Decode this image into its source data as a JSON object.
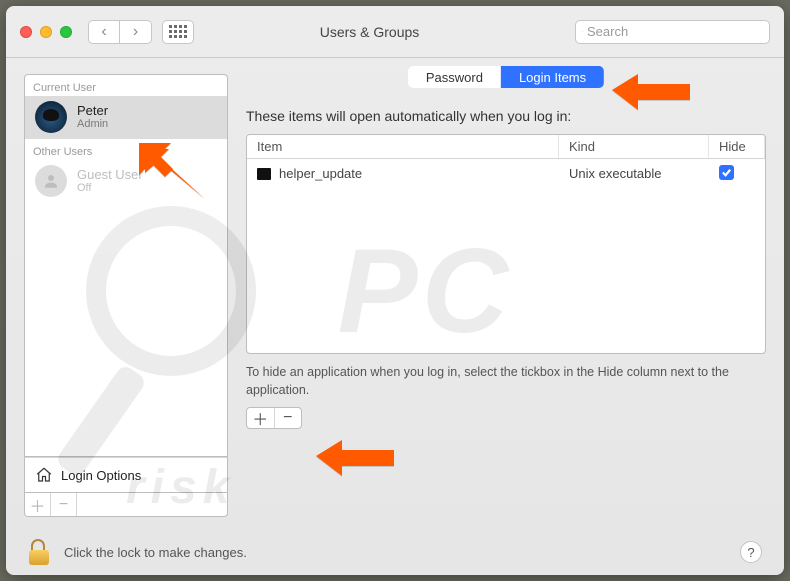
{
  "toolbar": {
    "title": "Users & Groups",
    "search_placeholder": "Search"
  },
  "sidebar": {
    "current_label": "Current User",
    "other_label": "Other Users",
    "users": [
      {
        "name": "Peter",
        "role": "Admin"
      },
      {
        "name": "Guest User",
        "role": "Off"
      }
    ],
    "login_options": "Login Options"
  },
  "tabs": {
    "password": "Password",
    "login_items": "Login Items"
  },
  "main": {
    "description": "These items will open automatically when you log in:",
    "columns": {
      "item": "Item",
      "kind": "Kind",
      "hide": "Hide"
    },
    "rows": [
      {
        "item": "helper_update",
        "kind": "Unix executable",
        "hide": true
      }
    ],
    "hint": "To hide an application when you log in, select the tickbox in the Hide column next to the application."
  },
  "footer": {
    "lock_text": "Click the lock to make changes."
  },
  "glyphs": {
    "plus": "＋",
    "minus": "−",
    "question": "?",
    "chev_left": "‹",
    "chev_right": "›"
  }
}
